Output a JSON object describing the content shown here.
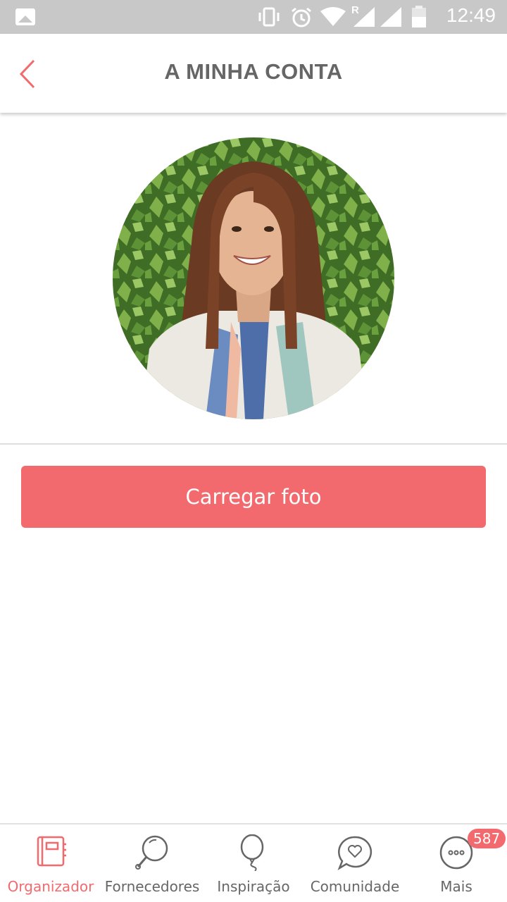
{
  "status_bar": {
    "time": "12:49",
    "roaming_indicator": "R",
    "icons": [
      "gallery-icon",
      "vibrate-icon",
      "alarm-icon",
      "wifi-icon",
      "signal-icon",
      "signal-icon",
      "battery-icon"
    ]
  },
  "header": {
    "title": "A MINHA CONTA",
    "back_icon": "chevron-left-icon"
  },
  "profile": {
    "photo": "profile-photo"
  },
  "actions": {
    "upload_label": "Carregar foto"
  },
  "colors": {
    "accent": "#f26a6e",
    "status_bar": "#c8c8c8",
    "text": "#666666"
  },
  "bottom_nav": {
    "items": [
      {
        "label": "Organizador",
        "icon": "planner-icon",
        "active": true
      },
      {
        "label": "Fornecedores",
        "icon": "search-icon",
        "active": false
      },
      {
        "label": "Inspiração",
        "icon": "balloon-icon",
        "active": false
      },
      {
        "label": "Comunidade",
        "icon": "chat-heart-icon",
        "active": false
      },
      {
        "label": "Mais",
        "icon": "more-icon",
        "active": false,
        "badge": "587"
      }
    ]
  }
}
